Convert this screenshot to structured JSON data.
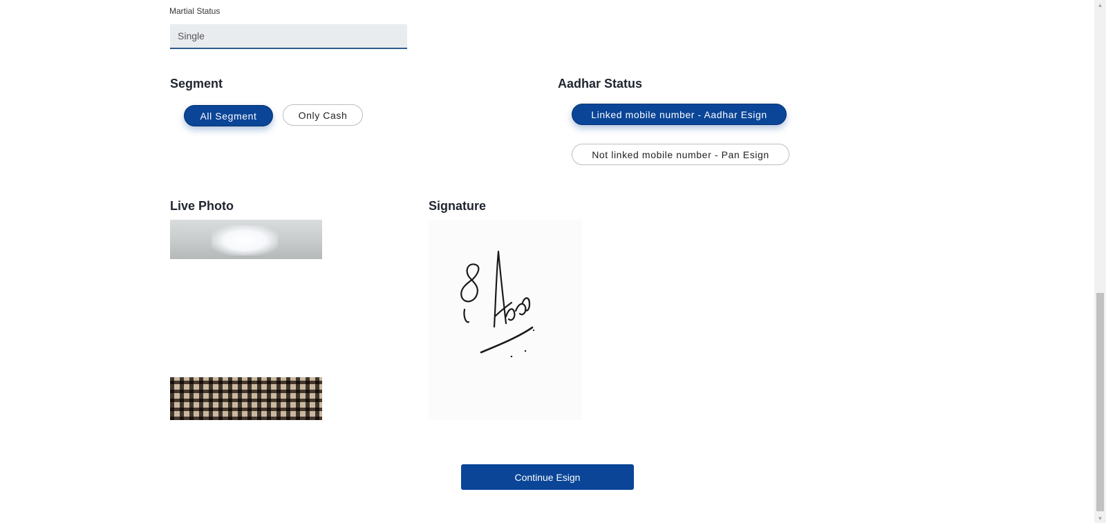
{
  "marital": {
    "label": "Martial Status",
    "value": "Single"
  },
  "segment": {
    "title": "Segment",
    "options": [
      {
        "label": "All Segment",
        "selected": true
      },
      {
        "label": "Only Cash",
        "selected": false
      }
    ]
  },
  "aadhar": {
    "title": "Aadhar Status",
    "options": [
      {
        "label": "Linked mobile number - Aadhar Esign",
        "selected": true
      },
      {
        "label": "Not linked mobile number - Pan Esign",
        "selected": false
      }
    ]
  },
  "live_photo": {
    "title": "Live Photo"
  },
  "signature": {
    "title": "Signature"
  },
  "actions": {
    "continue_label": "Continue Esign"
  },
  "colors": {
    "primary": "#0a4597",
    "field_bg": "#e9ecef",
    "field_underline": "#2a5a8a"
  }
}
